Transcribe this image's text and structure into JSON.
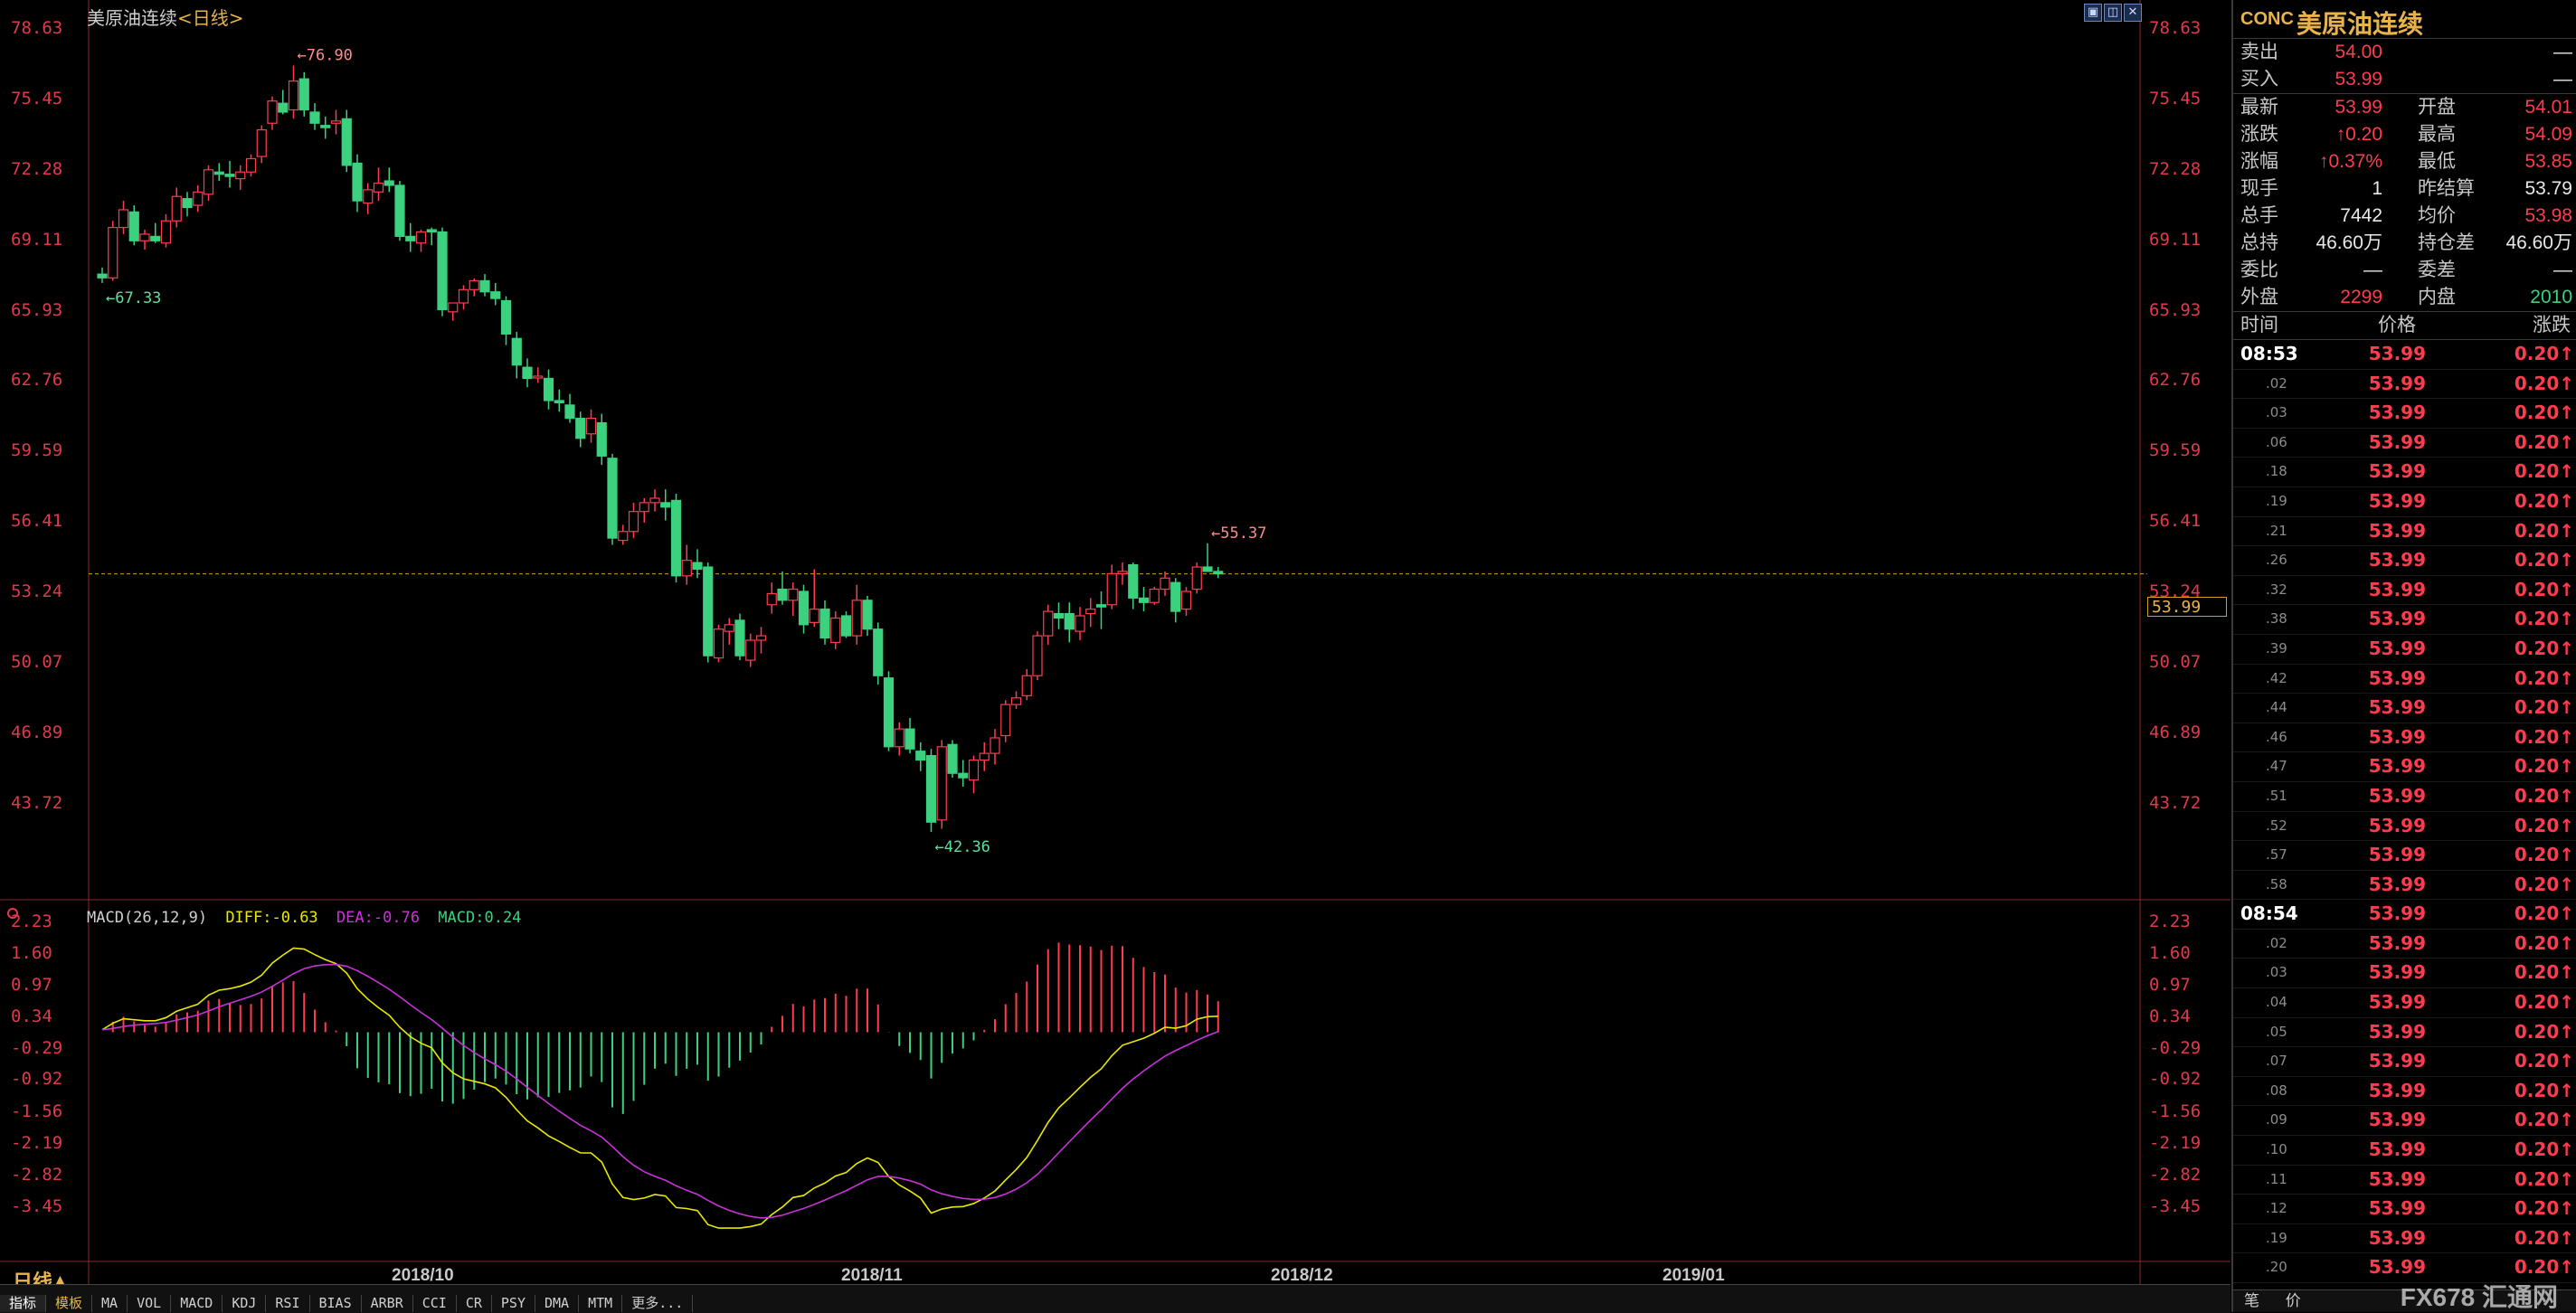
{
  "title": {
    "name": "美原油连续",
    "period": "<日线>"
  },
  "window_controls": [
    "▣",
    "◫",
    "✕"
  ],
  "y_axis_main": [
    "78.63",
    "75.45",
    "72.28",
    "69.11",
    "65.93",
    "62.76",
    "59.59",
    "56.41",
    "53.24",
    "50.07",
    "46.89",
    "43.72"
  ],
  "y_axis_macd": [
    "2.23",
    "1.60",
    "0.97",
    "0.34",
    "-0.29",
    "-0.92",
    "-1.56",
    "-2.19",
    "-2.82",
    "-3.45"
  ],
  "x_axis": [
    "2018/10",
    "2018/11",
    "2018/12",
    "2019/01"
  ],
  "annotations": {
    "high": "76.90",
    "low": "42.36",
    "start_low": "67.33",
    "recent_high": "55.37"
  },
  "current_price": "53.99",
  "macd_label": {
    "name": "MACD(26,12,9)",
    "diff": "DIFF:-0.63",
    "dea": "DEA:-0.76",
    "macd": "MACD:0.24"
  },
  "period_indicator": "日线▲",
  "tabs": [
    "指标",
    "模板",
    "MA",
    "VOL",
    "MACD",
    "KDJ",
    "RSI",
    "BIAS",
    "ARBR",
    "CCI",
    "CR",
    "PSY",
    "DMA",
    "MTM",
    "更多..."
  ],
  "colors": {
    "up": "#ff3b4e",
    "down": "#3bd17e",
    "diff": "#e8e800",
    "dea": "#c832d8",
    "accent": "#e8b34a"
  },
  "chart_data": {
    "type": "candlestick",
    "title": "美原油连续<日线>",
    "ylim": [
      42.36,
      78.63
    ],
    "series_ohlc": [
      [
        67.5,
        67.8,
        67.1,
        67.33
      ],
      [
        67.33,
        69.9,
        67.2,
        69.6
      ],
      [
        69.6,
        70.8,
        69.3,
        70.4
      ],
      [
        70.3,
        70.6,
        68.8,
        69.0
      ],
      [
        69.0,
        69.5,
        68.6,
        69.3
      ],
      [
        69.2,
        69.8,
        68.9,
        69.0
      ],
      [
        68.9,
        70.2,
        68.7,
        69.9
      ],
      [
        69.9,
        71.4,
        69.6,
        71.0
      ],
      [
        70.9,
        71.2,
        70.1,
        70.5
      ],
      [
        70.6,
        71.5,
        70.3,
        71.2
      ],
      [
        71.1,
        72.4,
        70.8,
        72.2
      ],
      [
        72.1,
        72.5,
        71.7,
        72.0
      ],
      [
        72.0,
        72.6,
        71.4,
        71.9
      ],
      [
        71.8,
        72.4,
        71.3,
        72.1
      ],
      [
        72.1,
        72.9,
        71.9,
        72.7
      ],
      [
        72.8,
        74.2,
        72.5,
        74.0
      ],
      [
        74.3,
        75.5,
        74.0,
        75.3
      ],
      [
        75.2,
        75.8,
        74.7,
        74.8
      ],
      [
        74.9,
        76.9,
        74.5,
        76.2
      ],
      [
        76.3,
        76.6,
        74.6,
        74.9
      ],
      [
        74.8,
        75.2,
        74.0,
        74.3
      ],
      [
        74.2,
        74.6,
        73.6,
        74.1
      ],
      [
        74.3,
        74.9,
        73.8,
        74.4
      ],
      [
        74.5,
        74.9,
        72.1,
        72.4
      ],
      [
        72.5,
        72.9,
        70.3,
        70.8
      ],
      [
        70.7,
        71.6,
        70.2,
        71.3
      ],
      [
        71.2,
        72.3,
        70.8,
        71.6
      ],
      [
        71.7,
        72.3,
        71.2,
        71.5
      ],
      [
        71.5,
        71.7,
        69.0,
        69.2
      ],
      [
        69.2,
        69.8,
        68.5,
        69.0
      ],
      [
        68.9,
        69.5,
        68.5,
        69.4
      ],
      [
        69.5,
        69.6,
        68.8,
        69.4
      ],
      [
        69.4,
        69.6,
        65.6,
        65.9
      ],
      [
        65.8,
        66.2,
        65.4,
        66.2
      ],
      [
        66.2,
        67.0,
        65.9,
        66.8
      ],
      [
        66.8,
        67.3,
        66.5,
        67.2
      ],
      [
        67.2,
        67.5,
        66.5,
        66.7
      ],
      [
        66.7,
        67.1,
        66.1,
        66.4
      ],
      [
        66.3,
        66.5,
        64.3,
        64.8
      ],
      [
        64.6,
        64.9,
        62.8,
        63.4
      ],
      [
        63.3,
        63.7,
        62.4,
        62.8
      ],
      [
        62.9,
        63.3,
        62.6,
        62.9
      ],
      [
        62.8,
        63.2,
        61.4,
        61.8
      ],
      [
        61.8,
        62.3,
        61.3,
        61.7
      ],
      [
        61.6,
        62.1,
        60.8,
        61.0
      ],
      [
        61.0,
        61.3,
        59.7,
        60.1
      ],
      [
        60.3,
        61.4,
        59.9,
        61.0
      ],
      [
        60.8,
        61.2,
        58.9,
        59.3
      ],
      [
        59.2,
        59.4,
        55.3,
        55.6
      ],
      [
        55.5,
        56.2,
        55.3,
        55.9
      ],
      [
        55.9,
        57.2,
        55.6,
        56.8
      ],
      [
        56.8,
        57.4,
        56.3,
        57.2
      ],
      [
        57.2,
        57.8,
        56.8,
        57.4
      ],
      [
        57.2,
        57.8,
        56.4,
        57.0
      ],
      [
        57.3,
        57.6,
        53.6,
        53.9
      ],
      [
        53.9,
        55.3,
        53.5,
        54.6
      ],
      [
        54.5,
        55.1,
        53.8,
        54.2
      ],
      [
        54.3,
        54.5,
        50.0,
        50.3
      ],
      [
        50.2,
        51.7,
        50.0,
        51.5
      ],
      [
        51.4,
        52.0,
        50.8,
        51.7
      ],
      [
        51.9,
        52.2,
        50.1,
        50.3
      ],
      [
        50.1,
        51.3,
        49.8,
        51.0
      ],
      [
        51.0,
        51.6,
        50.4,
        51.2
      ],
      [
        52.6,
        53.6,
        52.2,
        53.1
      ],
      [
        53.3,
        54.1,
        52.6,
        52.8
      ],
      [
        52.8,
        53.6,
        52.1,
        53.3
      ],
      [
        53.2,
        53.5,
        51.3,
        51.7
      ],
      [
        51.8,
        54.2,
        51.6,
        52.4
      ],
      [
        52.4,
        52.8,
        50.8,
        51.1
      ],
      [
        50.9,
        52.3,
        50.6,
        52.0
      ],
      [
        52.1,
        52.3,
        51.1,
        51.2
      ],
      [
        51.2,
        53.5,
        50.8,
        52.8
      ],
      [
        52.8,
        53.0,
        51.2,
        51.5
      ],
      [
        51.5,
        51.8,
        49.0,
        49.4
      ],
      [
        49.3,
        49.6,
        46.0,
        46.2
      ],
      [
        46.2,
        47.3,
        45.8,
        47.0
      ],
      [
        47.0,
        47.5,
        45.9,
        46.1
      ],
      [
        46.0,
        46.4,
        45.1,
        45.6
      ],
      [
        45.8,
        46.1,
        42.36,
        42.8
      ],
      [
        42.9,
        46.5,
        42.5,
        46.2
      ],
      [
        46.3,
        46.5,
        44.8,
        45.0
      ],
      [
        45.0,
        45.6,
        44.4,
        44.8
      ],
      [
        44.7,
        45.8,
        44.1,
        45.6
      ],
      [
        45.6,
        46.4,
        45.1,
        45.9
      ],
      [
        45.9,
        47.0,
        45.4,
        46.6
      ],
      [
        46.7,
        48.3,
        46.4,
        48.1
      ],
      [
        48.1,
        48.7,
        47.9,
        48.4
      ],
      [
        48.5,
        49.7,
        48.3,
        49.4
      ],
      [
        49.4,
        51.4,
        49.2,
        51.2
      ],
      [
        51.2,
        52.6,
        50.8,
        52.3
      ],
      [
        52.2,
        52.7,
        51.5,
        52.0
      ],
      [
        52.2,
        52.7,
        50.9,
        51.5
      ],
      [
        51.4,
        52.5,
        51.0,
        52.1
      ],
      [
        52.2,
        52.9,
        51.6,
        52.4
      ],
      [
        52.6,
        53.2,
        51.5,
        52.5
      ],
      [
        52.6,
        54.4,
        52.4,
        54.0
      ],
      [
        54.0,
        54.5,
        53.5,
        54.1
      ],
      [
        54.4,
        54.5,
        52.4,
        52.9
      ],
      [
        52.9,
        53.4,
        52.3,
        52.7
      ],
      [
        52.7,
        53.4,
        52.6,
        53.3
      ],
      [
        53.3,
        54.1,
        53.0,
        53.8
      ],
      [
        53.6,
        53.8,
        51.8,
        52.3
      ],
      [
        52.4,
        53.4,
        52.1,
        53.2
      ],
      [
        53.3,
        54.5,
        53.1,
        54.3
      ],
      [
        54.3,
        55.37,
        54.1,
        54.1
      ],
      [
        54.1,
        54.3,
        53.8,
        53.99
      ]
    ],
    "macd_ylim": [
      -3.8,
      2.23
    ],
    "diff": [
      0.05,
      0.18,
      0.27,
      0.25,
      0.23,
      0.23,
      0.29,
      0.42,
      0.49,
      0.56,
      0.74,
      0.84,
      0.87,
      0.92,
      1.0,
      1.14,
      1.38,
      1.54,
      1.68,
      1.66,
      1.55,
      1.45,
      1.37,
      1.18,
      0.87,
      0.66,
      0.49,
      0.34,
      0.1,
      -0.09,
      -0.22,
      -0.31,
      -0.61,
      -0.81,
      -0.93,
      -0.98,
      -1.03,
      -1.11,
      -1.3,
      -1.55,
      -1.77,
      -1.91,
      -2.07,
      -2.18,
      -2.3,
      -2.41,
      -2.41,
      -2.59,
      -3.03,
      -3.3,
      -3.34,
      -3.31,
      -3.24,
      -3.27,
      -3.5,
      -3.52,
      -3.56,
      -3.84,
      -3.91,
      -3.91,
      -3.91,
      -3.88,
      -3.83,
      -3.64,
      -3.49,
      -3.3,
      -3.26,
      -3.11,
      -3.01,
      -2.87,
      -2.8,
      -2.62,
      -2.51,
      -2.6,
      -2.88,
      -3.05,
      -3.17,
      -3.31,
      -3.61,
      -3.53,
      -3.49,
      -3.48,
      -3.42,
      -3.31,
      -3.17,
      -2.95,
      -2.74,
      -2.5,
      -2.16,
      -1.8,
      -1.51,
      -1.31,
      -1.1,
      -0.9,
      -0.73,
      -0.47,
      -0.26,
      -0.19,
      -0.12,
      -0.02,
      0.1,
      0.08,
      0.13,
      0.26,
      0.31,
      0.32
    ]
  },
  "panel": {
    "code": "CONC",
    "name": "美原油连续",
    "quotes": [
      {
        "l1": "卖出",
        "v1": "54.00",
        "c1": "red",
        "l2": "",
        "v2": "—",
        "c2": "white"
      },
      {
        "l1": "买入",
        "v1": "53.99",
        "c1": "red",
        "l2": "",
        "v2": "—",
        "c2": "white"
      }
    ],
    "stats": [
      {
        "l1": "最新",
        "v1": "53.99",
        "c1": "red",
        "l2": "开盘",
        "v2": "54.01",
        "c2": "red"
      },
      {
        "l1": "涨跌",
        "v1": "↑0.20",
        "c1": "red",
        "l2": "最高",
        "v2": "54.09",
        "c2": "red"
      },
      {
        "l1": "涨幅",
        "v1": "↑0.37%",
        "c1": "red",
        "l2": "最低",
        "v2": "53.85",
        "c2": "red"
      },
      {
        "l1": "现手",
        "v1": "1",
        "c1": "white",
        "l2": "昨结算",
        "v2": "53.79",
        "c2": "white"
      },
      {
        "l1": "总手",
        "v1": "7442",
        "c1": "white",
        "l2": "均价",
        "v2": "53.98",
        "c2": "red"
      },
      {
        "l1": "总持",
        "v1": "46.60万",
        "c1": "white",
        "l2": "持仓差",
        "v2": "46.60万",
        "c2": "white"
      },
      {
        "l1": "委比",
        "v1": "—",
        "c1": "white",
        "l2": "委差",
        "v2": "—",
        "c2": "white"
      },
      {
        "l1": "外盘",
        "v1": "2299",
        "c1": "red",
        "l2": "内盘",
        "v2": "2010",
        "c2": "green"
      }
    ],
    "ticks_header": {
      "time": "时间",
      "price": "价格",
      "change": "涨跌"
    },
    "ticks": [
      {
        "t": "08:53",
        "main": true
      },
      {
        "t": ".02"
      },
      {
        "t": ".03"
      },
      {
        "t": ".06"
      },
      {
        "t": ".18"
      },
      {
        "t": ".19"
      },
      {
        "t": ".21"
      },
      {
        "t": ".26"
      },
      {
        "t": ".32"
      },
      {
        "t": ".38"
      },
      {
        "t": ".39"
      },
      {
        "t": ".42"
      },
      {
        "t": ".44"
      },
      {
        "t": ".46"
      },
      {
        "t": ".47"
      },
      {
        "t": ".51"
      },
      {
        "t": ".52"
      },
      {
        "t": ".57"
      },
      {
        "t": ".58"
      },
      {
        "t": "08:54",
        "main": true
      },
      {
        "t": ".02"
      },
      {
        "t": ".03"
      },
      {
        "t": ".04"
      },
      {
        "t": ".05"
      },
      {
        "t": ".07"
      },
      {
        "t": ".08"
      },
      {
        "t": ".09"
      },
      {
        "t": ".10"
      },
      {
        "t": ".11"
      },
      {
        "t": ".12"
      },
      {
        "t": ".19"
      },
      {
        "t": ".20"
      }
    ],
    "tick_price": "53.99",
    "tick_change": "0.20↑",
    "foot": [
      "笔",
      "价"
    ],
    "watermark": "FX678 汇通网"
  }
}
